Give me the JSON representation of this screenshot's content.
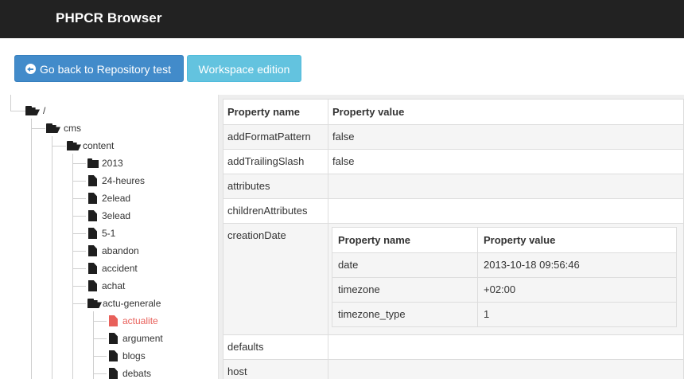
{
  "app": {
    "title": "PHPCR Browser"
  },
  "toolbar": {
    "back_label": "Go back to Repository test",
    "workspace_label": "Workspace edition"
  },
  "tree": {
    "root": "/",
    "cms": "cms",
    "content": "content",
    "items": [
      "2013",
      "24-heures",
      "2elead",
      "3elead",
      "5-1",
      "abandon",
      "accident",
      "achat"
    ],
    "actu_generale": "actu-generale",
    "children": [
      "actualite",
      "argument",
      "blogs",
      "debats"
    ],
    "selected": "actualite"
  },
  "properties": {
    "headers": [
      "Property name",
      "Property value"
    ],
    "rows": [
      {
        "name": "addFormatPattern",
        "value": "false"
      },
      {
        "name": "addTrailingSlash",
        "value": "false"
      },
      {
        "name": "attributes",
        "value": ""
      },
      {
        "name": "childrenAttributes",
        "value": ""
      },
      {
        "name": "creationDate",
        "value": ""
      },
      {
        "name": "defaults",
        "value": ""
      },
      {
        "name": "host",
        "value": ""
      }
    ],
    "creation_date": {
      "headers": [
        "Property name",
        "Property value"
      ],
      "rows": [
        {
          "name": "date",
          "value": "2013-10-18 09:56:46"
        },
        {
          "name": "timezone",
          "value": "+02:00"
        },
        {
          "name": "timezone_type",
          "value": "1"
        }
      ]
    }
  },
  "colors": {
    "navbar": "#222222",
    "primary": "#428bca",
    "info": "#5bc0de",
    "selected_node": "#e8605a"
  },
  "icons": {
    "back": "circle-arrow-left-icon",
    "open_folder": "folder-open-icon",
    "closed_folder": "folder-closed-icon",
    "file": "file-icon"
  }
}
